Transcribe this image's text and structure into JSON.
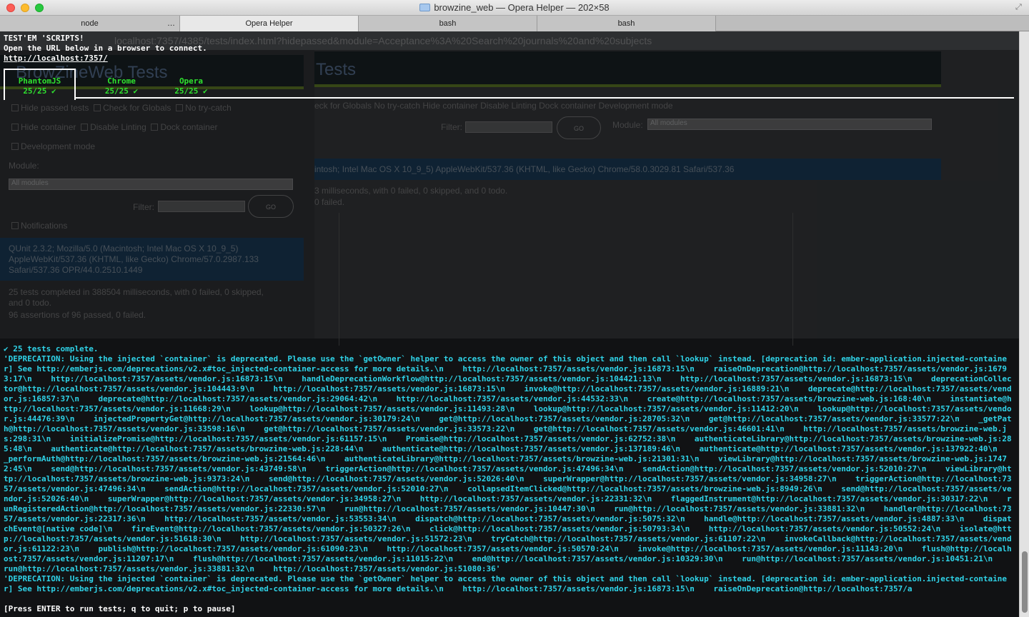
{
  "window": {
    "title": "browzine_web — Opera Helper — 202×58"
  },
  "tabs": [
    {
      "label": "node",
      "extra": "…"
    },
    {
      "label": "Opera Helper"
    },
    {
      "label": "bash"
    },
    {
      "label": "bash"
    }
  ],
  "background_browser": {
    "url": "localhost:7357/4385/tests/index.html?hidepassed&module=Acceptance%3A%20Search%20journals%20and%20subjects",
    "left_title": "BrowZineWeb Tests",
    "right_title": "Tests",
    "checkboxes_left": [
      "Hide passed tests",
      "Check for Globals",
      "No try-catch",
      "Hide container",
      "Disable Linting",
      "Dock container",
      "Development mode"
    ],
    "checkboxes_right": "eck for Globals   No try-catch   Hide container   Disable Linting   Dock container   Development mode",
    "module_label": "Module:",
    "module_value": "All modules",
    "filter_label": "Filter:",
    "go_label": "GO",
    "notifications": "Notifications",
    "ua_left": "QUnit 2.3.2; Mozilla/5.0 (Macintosh; Intel Mac OS X 10_9_5) AppleWebKit/537.36 (KHTML, like Gecko) Chrome/57.0.2987.133 Safari/537.36 OPR/44.0.2510.1449",
    "ua_right": "intosh; Intel Mac OS X 10_9_5) AppleWebKit/537.36 (KHTML, like Gecko) Chrome/58.0.3029.81 Safari/537.36",
    "result_left": "25 tests completed in 388504 milliseconds, with 0 failed, 0 skipped, and 0 todo.",
    "assertions_left": "96 assertions of 96 passed, 0 failed.",
    "result_right": "3 milliseconds, with 0 failed, 0 skipped, and 0 todo.",
    "failed_right": "0 failed."
  },
  "testem": {
    "header": "TEST'EM 'SCRIPTS!",
    "instructions": "Open the URL below in a browser to connect.",
    "connect_url": "http://localhost:7357/",
    "browsers": [
      {
        "name": "PhantomJS",
        "result": "25/25 ✔"
      },
      {
        "name": "Chrome",
        "result": "25/25 ✔"
      },
      {
        "name": "Opera",
        "result": "25/25 ✔"
      }
    ],
    "complete": "✔ 25 tests complete.",
    "log": "'DEPRECATION: Using the injected `container` is deprecated. Please use the `getOwner` helper to access the owner of this object and then call `lookup` instead. [deprecation id: ember-application.injected-container] See http://emberjs.com/deprecations/v2.x#toc_injected-container-access for more details.\\n    http://localhost:7357/assets/vendor.js:16873:15\\n    raiseOnDeprecation@http://localhost:7357/assets/vendor.js:16793:17\\n    http://localhost:7357/assets/vendor.js:16873:15\\n    handleDeprecationWorkflow@http://localhost:7357/assets/vendor.js:104421:13\\n    http://localhost:7357/assets/vendor.js:16873:15\\n    deprecationCollector@http://localhost:7357/assets/vendor.js:104443:9\\n    http://localhost:7357/assets/vendor.js:16873:15\\n    invoke@http://localhost:7357/assets/vendor.js:16889:21\\n    deprecate@http://localhost:7357/assets/vendor.js:16857:37\\n    deprecate@http://localhost:7357/assets/vendor.js:29064:42\\n    http://localhost:7357/assets/vendor.js:44532:33\\n    create@http://localhost:7357/assets/browzine-web.js:168:40\\n    instantiate@http://localhost:7357/assets/vendor.js:11668:29\\n    lookup@http://localhost:7357/assets/vendor.js:11493:28\\n    lookup@http://localhost:7357/assets/vendor.js:11412:20\\n    lookup@http://localhost:7357/assets/vendor.js:44476:39\\n    injectedPropertyGet@http://localhost:7357/assets/vendor.js:30179:24\\n    get@http://localhost:7357/assets/vendor.js:28705:32\\n    get@http://localhost:7357/assets/vendor.js:33577:22\\n    _getPath@http://localhost:7357/assets/vendor.js:33598:16\\n    get@http://localhost:7357/assets/vendor.js:33573:22\\n    get@http://localhost:7357/assets/vendor.js:46601:41\\n    http://localhost:7357/assets/browzine-web.js:298:31\\n    initializePromise@http://localhost:7357/assets/vendor.js:61157:15\\n    Promise@http://localhost:7357/assets/vendor.js:62752:38\\n    authenticateLibrary@http://localhost:7357/assets/browzine-web.js:285:48\\n    authenticate@http://localhost:7357/assets/browzine-web.js:228:44\\n    authenticate@http://localhost:7357/assets/vendor.js:137189:46\\n    authenticate@http://localhost:7357/assets/vendor.js:137922:40\\n    _performAuth@http://localhost:7357/assets/browzine-web.js:21564:46\\n    authenticateLibrary@http://localhost:7357/assets/browzine-web.js:21301:31\\n    viewLibrary@http://localhost:7357/assets/browzine-web.js:17472:45\\n    send@http://localhost:7357/assets/vendor.js:43749:58\\n    triggerAction@http://localhost:7357/assets/vendor.js:47496:34\\n    sendAction@http://localhost:7357/assets/vendor.js:52010:27\\n    viewLibrary@http://localhost:7357/assets/browzine-web.js:9373:24\\n    send@http://localhost:7357/assets/vendor.js:52026:40\\n    superWrapper@http://localhost:7357/assets/vendor.js:34958:27\\n    triggerAction@http://localhost:7357/assets/vendor.js:47496:34\\n    sendAction@http://localhost:7357/assets/vendor.js:52010:27\\n    collapsedItemClicked@http://localhost:7357/assets/browzine-web.js:8949:26\\n    send@http://localhost:7357/assets/vendor.js:52026:40\\n    superWrapper@http://localhost:7357/assets/vendor.js:34958:27\\n    http://localhost:7357/assets/vendor.js:22331:32\\n    flaggedInstrument@http://localhost:7357/assets/vendor.js:30317:22\\n    runRegisteredAction@http://localhost:7357/assets/vendor.js:22330:57\\n    run@http://localhost:7357/assets/vendor.js:10447:30\\n    run@http://localhost:7357/assets/vendor.js:33881:32\\n    handler@http://localhost:7357/assets/vendor.js:22317:36\\n    http://localhost:7357/assets/vendor.js:53553:34\\n    dispatch@http://localhost:7357/assets/vendor.js:5075:32\\n    handle@http://localhost:7357/assets/vendor.js:4887:33\\n    dispatchEvent@[native code]\\n    fireEvent@http://localhost:7357/assets/vendor.js:50327:26\\n    click@http://localhost:7357/assets/vendor.js:50793:34\\n    http://localhost:7357/assets/vendor.js:50552:24\\n    isolate@http://localhost:7357/assets/vendor.js:51618:30\\n    http://localhost:7357/assets/vendor.js:51572:23\\n    tryCatch@http://localhost:7357/assets/vendor.js:61107:22\\n    invokeCallback@http://localhost:7357/assets/vendor.js:61122:23\\n    publish@http://localhost:7357/assets/vendor.js:61090:23\\n    http://localhost:7357/assets/vendor.js:50570:24\\n    invoke@http://localhost:7357/assets/vendor.js:11143:20\\n    flush@http://localhost:7357/assets/vendor.js:11207:17\\n    flush@http://localhost:7357/assets/vendor.js:11015:22\\n    end@http://localhost:7357/assets/vendor.js:10329:30\\n    run@http://localhost:7357/assets/vendor.js:10451:21\\n    run@http://localhost:7357/assets/vendor.js:33881:32\\n    http://localhost:7357/assets/vendor.js:51080:36'\n'DEPRECATION: Using the injected `container` is deprecated. Please use the `getOwner` helper to access the owner of this object and then call `lookup` instead. [deprecation id: ember-application.injected-container] See http://emberjs.com/deprecations/v2.x#toc_injected-container-access for more details.\\n    http://localhost:7357/assets/vendor.js:16873:15\\n    raiseOnDeprecation@http://localhost:7357/a",
    "prompt": "[Press ENTER to run tests; q to quit; p to pause]"
  }
}
